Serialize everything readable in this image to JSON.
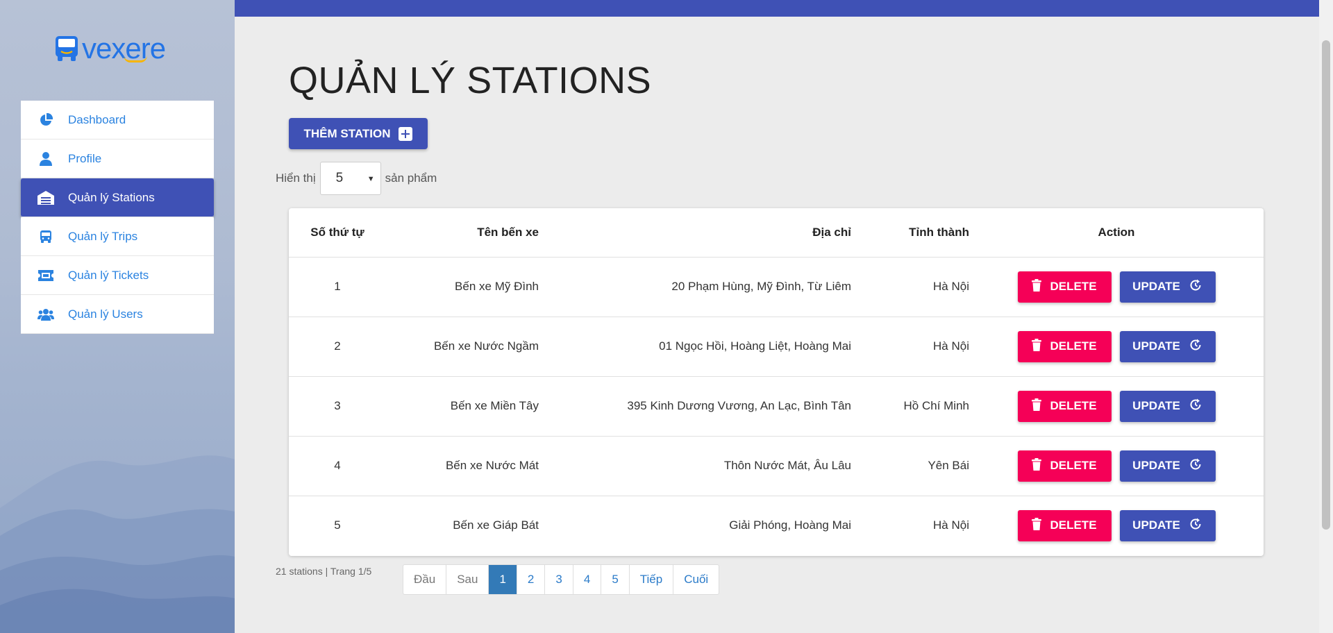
{
  "brand": {
    "logo_text": "vexere"
  },
  "sidebar": {
    "items": [
      {
        "label": "Dashboard",
        "icon": "pie-chart-icon",
        "active": false
      },
      {
        "label": "Profile",
        "icon": "user-icon",
        "active": false
      },
      {
        "label": "Quản lý Stations",
        "icon": "warehouse-icon",
        "active": true
      },
      {
        "label": "Quản lý Trips",
        "icon": "bus-icon",
        "active": false
      },
      {
        "label": "Quản lý Tickets",
        "icon": "ticket-icon",
        "active": false
      },
      {
        "label": "Quản lý Users",
        "icon": "users-icon",
        "active": false
      }
    ]
  },
  "main": {
    "title": "QUẢN LÝ STATIONS",
    "add_button": "THÊM STATION",
    "show_prefix": "Hiển thị",
    "page_size": "5",
    "show_suffix": "sản phẩm",
    "table": {
      "headers": [
        "Số thứ tự",
        "Tên bến xe",
        "Địa chỉ",
        "Tỉnh thành",
        "Action"
      ],
      "rows": [
        {
          "no": "1",
          "name": "Bến xe Mỹ Đình",
          "address": "20 Phạm Hùng, Mỹ Đình, Từ Liêm",
          "province": "Hà Nội"
        },
        {
          "no": "2",
          "name": "Bến xe Nước Ngầm",
          "address": "01 Ngọc Hồi, Hoàng Liệt, Hoàng Mai",
          "province": "Hà Nội"
        },
        {
          "no": "3",
          "name": "Bến xe Miền Tây",
          "address": "395 Kinh Dương Vương, An Lạc, Bình Tân",
          "province": "Hồ Chí Minh"
        },
        {
          "no": "4",
          "name": "Bến xe Nước Mát",
          "address": "Thôn Nước Mát, Âu Lâu",
          "province": "Yên Bái"
        },
        {
          "no": "5",
          "name": "Bến xe Giáp Bát",
          "address": "Giải Phóng, Hoàng Mai",
          "province": "Hà Nội"
        }
      ],
      "delete_label": "DELETE",
      "update_label": "UPDATE"
    },
    "footer": {
      "summary": "21 stations | Trang 1/5",
      "pages": [
        "Đầu",
        "Sau",
        "1",
        "2",
        "3",
        "4",
        "5",
        "Tiếp",
        "Cuối"
      ],
      "active_page": "1"
    }
  },
  "colors": {
    "primary": "#3f51b5",
    "danger": "#f50057",
    "link": "#2b83e0"
  }
}
